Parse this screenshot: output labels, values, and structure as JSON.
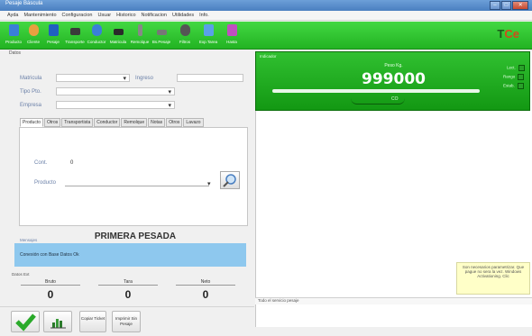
{
  "window": {
    "title": "Pesaje Báscula",
    "buttons": [
      "–",
      "□",
      "✕"
    ]
  },
  "menu": [
    "Ayda",
    "Mantenimiento",
    "Configuracion",
    "Usuar",
    "Historico",
    "Notificacion",
    "Utilidades",
    "Info."
  ],
  "toolbar": [
    {
      "label": "Producto",
      "icon": "product-icon",
      "color": "#3a7fd8"
    },
    {
      "label": "Cliente",
      "icon": "client-icon",
      "color": "#e8a040"
    },
    {
      "label": "Pesaje",
      "icon": "weigh-icon",
      "color": "#2060c0"
    },
    {
      "label": "Transporte",
      "icon": "truck-icon",
      "color": "#3a3a3a"
    },
    {
      "label": "Conductor",
      "icon": "driver-icon",
      "color": "#3a7fd8"
    },
    {
      "label": "Matricula",
      "icon": "plate-icon",
      "color": "#2a2a2a"
    },
    {
      "label": "Remolque",
      "icon": "trailer-icon",
      "color": "#888888"
    },
    {
      "label": "Bs.Pesaje",
      "icon": "search-icon",
      "color": "#777777"
    },
    {
      "label": "Filtros",
      "icon": "filter-icon",
      "color": "#555555"
    },
    {
      "label": "Exp.Tarea",
      "icon": "export-icon",
      "color": "#5aa0e8"
    },
    {
      "label": "Hasta",
      "icon": "report-icon",
      "color": "#c050c0"
    }
  ],
  "logo": {
    "text_a": "T",
    "text_b": "Ce"
  },
  "left": {
    "section_title": "Datos",
    "matricula_label": "Matricula",
    "ingreso_label": "Ingreso",
    "tipo_label": "Tipo Pto.",
    "empresa_label": "Empresa",
    "tabs": [
      "Producto",
      "Otros",
      "Transportista",
      "Conductor",
      "Remolque",
      "Notas",
      "Otros",
      "Lavazo"
    ],
    "cont_label": "Cont.",
    "cont_value": "0",
    "producto_label": "Producto"
  },
  "primera": "PRIMERA PESADA",
  "mensaje": {
    "label": "Mensajes",
    "text": "Conexión con Base Datos Ok"
  },
  "weights": {
    "title": "Datos Ext",
    "columns": [
      {
        "label": "Bruto",
        "value": "0"
      },
      {
        "label": "Tara",
        "value": "0"
      },
      {
        "label": "Neto",
        "value": "0"
      }
    ]
  },
  "bottom_buttons": [
    {
      "label": "",
      "icon": "check-icon"
    },
    {
      "label": "",
      "icon": "chart-icon"
    },
    {
      "label": "Copiar Ticket"
    },
    {
      "label": "Imprimir Sin Pesaje"
    }
  ],
  "display": {
    "title": "Indicador",
    "peso_label": "Peso Kg.",
    "peso_value": "999000",
    "indicator_label": "CO",
    "side": [
      "Lect.",
      "Rango",
      "Estab."
    ],
    "accent": "#1fae1f"
  },
  "tooltip": "Son necesarios parametrizar. Que pague no sera la vez. Windows Activationing. Clic",
  "status": "Todo el servicio pesaje"
}
